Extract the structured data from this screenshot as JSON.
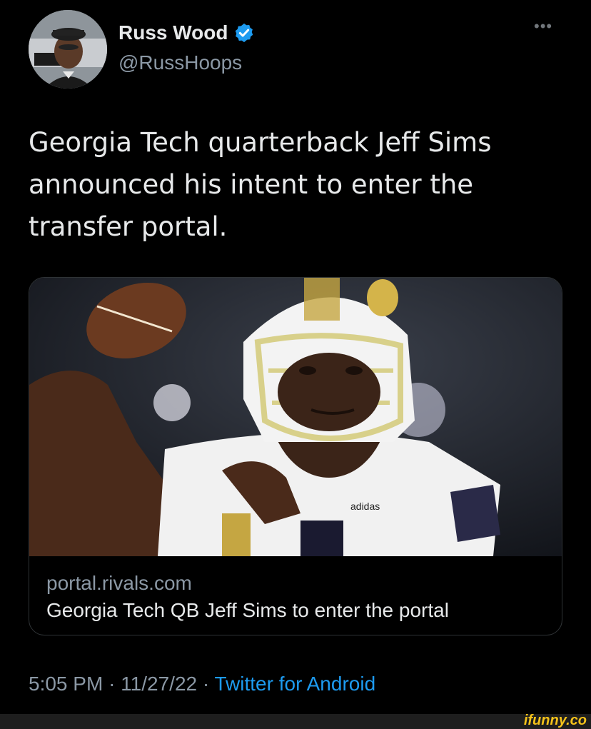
{
  "tweet": {
    "author": {
      "display_name": "Russ Wood",
      "handle": "@RussHoops",
      "verified": true,
      "avatar_icon": "profile-photo"
    },
    "more_icon": "more-options-icon",
    "text": "Georgia Tech quarterback Jeff Sims announced his intent to enter the transfer portal.",
    "card": {
      "image_icon": "football-quarterback-photo",
      "domain": "portal.rivals.com",
      "title": "Georgia Tech QB Jeff Sims to enter the portal"
    },
    "meta": {
      "time": "5:05 PM",
      "date": "11/27/22",
      "separator": "·",
      "source": "Twitter for Android"
    }
  },
  "watermark": "ifunny.co",
  "colors": {
    "background": "#000000",
    "text": "#e7e9ea",
    "secondary": "#8b98a5",
    "link": "#1d9bf0",
    "card_border": "#2f3336",
    "verified": "#1d9bf0",
    "watermark": "#f4c21a"
  }
}
